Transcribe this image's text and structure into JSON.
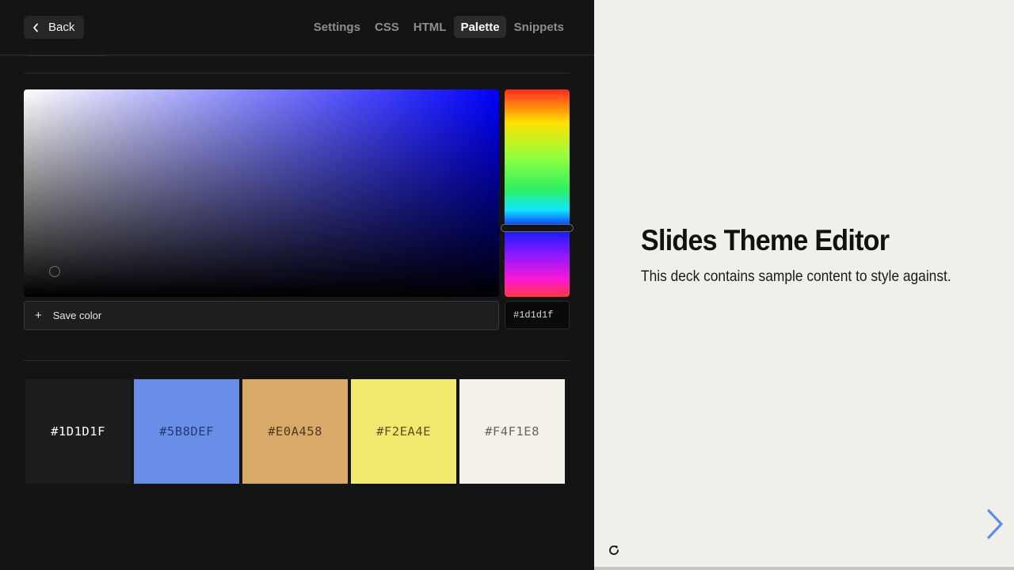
{
  "toolbar": {
    "back_label": "Back",
    "tabs": [
      {
        "label": "Settings",
        "active": false
      },
      {
        "label": "CSS",
        "active": false
      },
      {
        "label": "HTML",
        "active": false
      },
      {
        "label": "Palette",
        "active": true
      },
      {
        "label": "Snippets",
        "active": false
      }
    ]
  },
  "picker": {
    "hue_color": "#0000ff",
    "selected_color": "#1d1d1f",
    "hex_value": "#1d1d1f",
    "save_label": "Save color",
    "save_icon": "plus-icon"
  },
  "palette": [
    {
      "hex": "#1D1D1F",
      "bg": "#1d1d1f",
      "fg": "#ffffff"
    },
    {
      "hex": "#5B8DEF",
      "bg": "#6a8de8",
      "fg": "#233a73"
    },
    {
      "hex": "#E0A458",
      "bg": "#d9a96a",
      "fg": "#4f3a1f"
    },
    {
      "hex": "#F2EA4E",
      "bg": "#f1e96e",
      "fg": "#57531e"
    },
    {
      "hex": "#F4F1E8",
      "bg": "#f3f1ea",
      "fg": "#666666"
    }
  ],
  "preview": {
    "title": "Slides Theme Editor",
    "subtitle": "This deck contains sample content to style against.",
    "accent_color": "#5b8def",
    "icons": [
      "chevron-right-icon",
      "reload-icon"
    ]
  }
}
